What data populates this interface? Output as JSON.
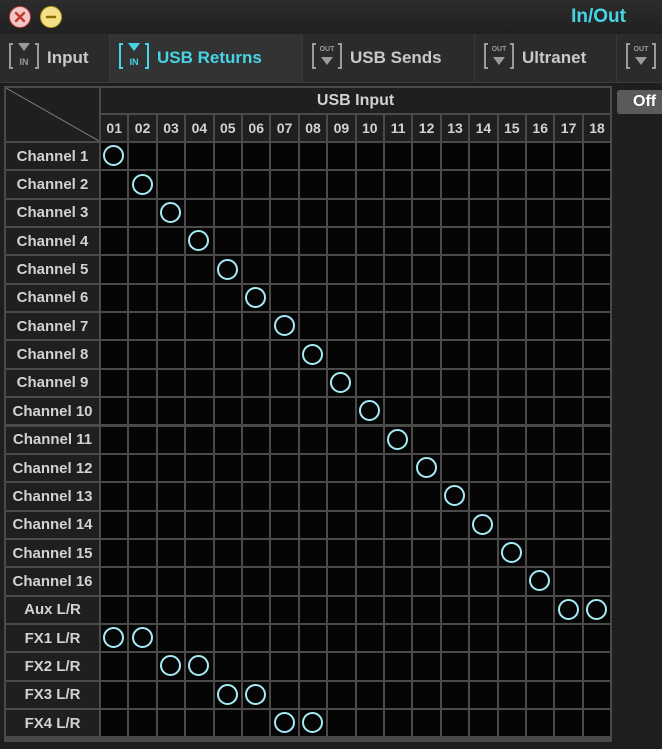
{
  "window": {
    "title": "In/Out",
    "close_icon": "close-icon",
    "minimize_icon": "minimize-icon"
  },
  "tabs": [
    {
      "label": "Input",
      "icon": "input-port-icon",
      "active": false
    },
    {
      "label": "USB Returns",
      "icon": "input-port-icon",
      "active": true
    },
    {
      "label": "USB Sends",
      "icon": "output-port-icon",
      "active": false
    },
    {
      "label": "Ultranet",
      "icon": "output-port-icon",
      "active": false
    },
    {
      "label": "",
      "icon": "output-port-icon",
      "active": false
    }
  ],
  "matrix": {
    "column_header": "USB Input",
    "columns": [
      "01",
      "02",
      "03",
      "04",
      "05",
      "06",
      "07",
      "08",
      "09",
      "10",
      "11",
      "12",
      "13",
      "14",
      "15",
      "16",
      "17",
      "18"
    ],
    "rows": [
      "Channel 1",
      "Channel 2",
      "Channel 3",
      "Channel 4",
      "Channel 5",
      "Channel 6",
      "Channel 7",
      "Channel 8",
      "Channel 9",
      "Channel 10",
      "Channel 11",
      "Channel 12",
      "Channel 13",
      "Channel 14",
      "Channel 15",
      "Channel 16",
      "Aux L/R",
      "FX1 L/R",
      "FX2 L/R",
      "FX3 L/R",
      "FX4 L/R"
    ],
    "connections": [
      [
        0,
        0
      ],
      [
        1,
        1
      ],
      [
        2,
        2
      ],
      [
        3,
        3
      ],
      [
        4,
        4
      ],
      [
        5,
        5
      ],
      [
        6,
        6
      ],
      [
        7,
        7
      ],
      [
        8,
        8
      ],
      [
        9,
        9
      ],
      [
        10,
        10
      ],
      [
        11,
        11
      ],
      [
        12,
        12
      ],
      [
        13,
        13
      ],
      [
        14,
        14
      ],
      [
        15,
        15
      ],
      [
        16,
        16
      ],
      [
        16,
        17
      ],
      [
        17,
        0
      ],
      [
        17,
        1
      ],
      [
        18,
        2
      ],
      [
        18,
        3
      ],
      [
        19,
        4
      ],
      [
        19,
        5
      ],
      [
        20,
        6
      ],
      [
        20,
        7
      ]
    ],
    "ring_color": "#a6ebf5"
  },
  "side": {
    "off_label": "Off"
  },
  "colors": {
    "accent": "#47d4e6",
    "grid_bg": "#050505",
    "grid_line": "#4a4a4a"
  }
}
